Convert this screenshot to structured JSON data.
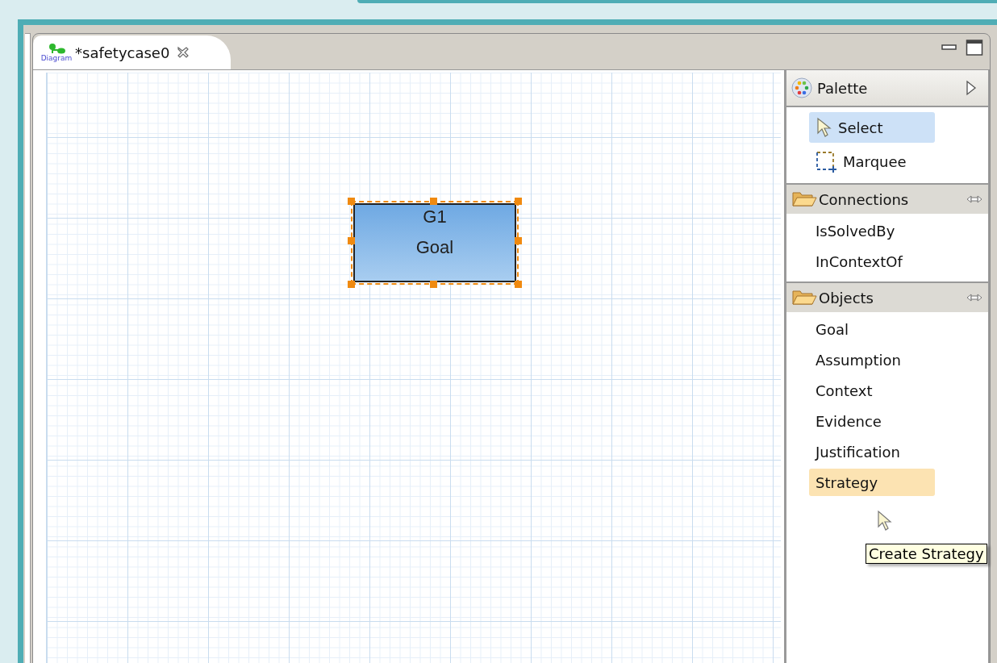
{
  "editor_tab": {
    "title": "*safetycase0",
    "icon_caption": "Diagram",
    "selected": true
  },
  "canvas": {
    "nodes": [
      {
        "id_label": "G1",
        "type_label": "Goal",
        "selected": true
      }
    ]
  },
  "palette": {
    "title": "Palette",
    "tools": [
      {
        "label": "Select",
        "kind": "pointer",
        "selected": true,
        "hovered": false
      },
      {
        "label": "Marquee",
        "kind": "marquee",
        "selected": false,
        "hovered": false
      }
    ],
    "drawers": [
      {
        "title": "Connections",
        "expanded": true,
        "items": [
          {
            "label": "IsSolvedBy",
            "selected": false,
            "hovered": false
          },
          {
            "label": "InContextOf",
            "selected": false,
            "hovered": false
          }
        ]
      },
      {
        "title": "Objects",
        "expanded": true,
        "items": [
          {
            "label": "Goal",
            "selected": false,
            "hovered": false
          },
          {
            "label": "Assumption",
            "selected": false,
            "hovered": false
          },
          {
            "label": "Context",
            "selected": false,
            "hovered": false
          },
          {
            "label": "Evidence",
            "selected": false,
            "hovered": false
          },
          {
            "label": "Justification",
            "selected": false,
            "hovered": false
          },
          {
            "label": "Strategy",
            "selected": false,
            "hovered": true
          }
        ]
      }
    ]
  },
  "tooltip": {
    "text": "Create Strategy"
  }
}
